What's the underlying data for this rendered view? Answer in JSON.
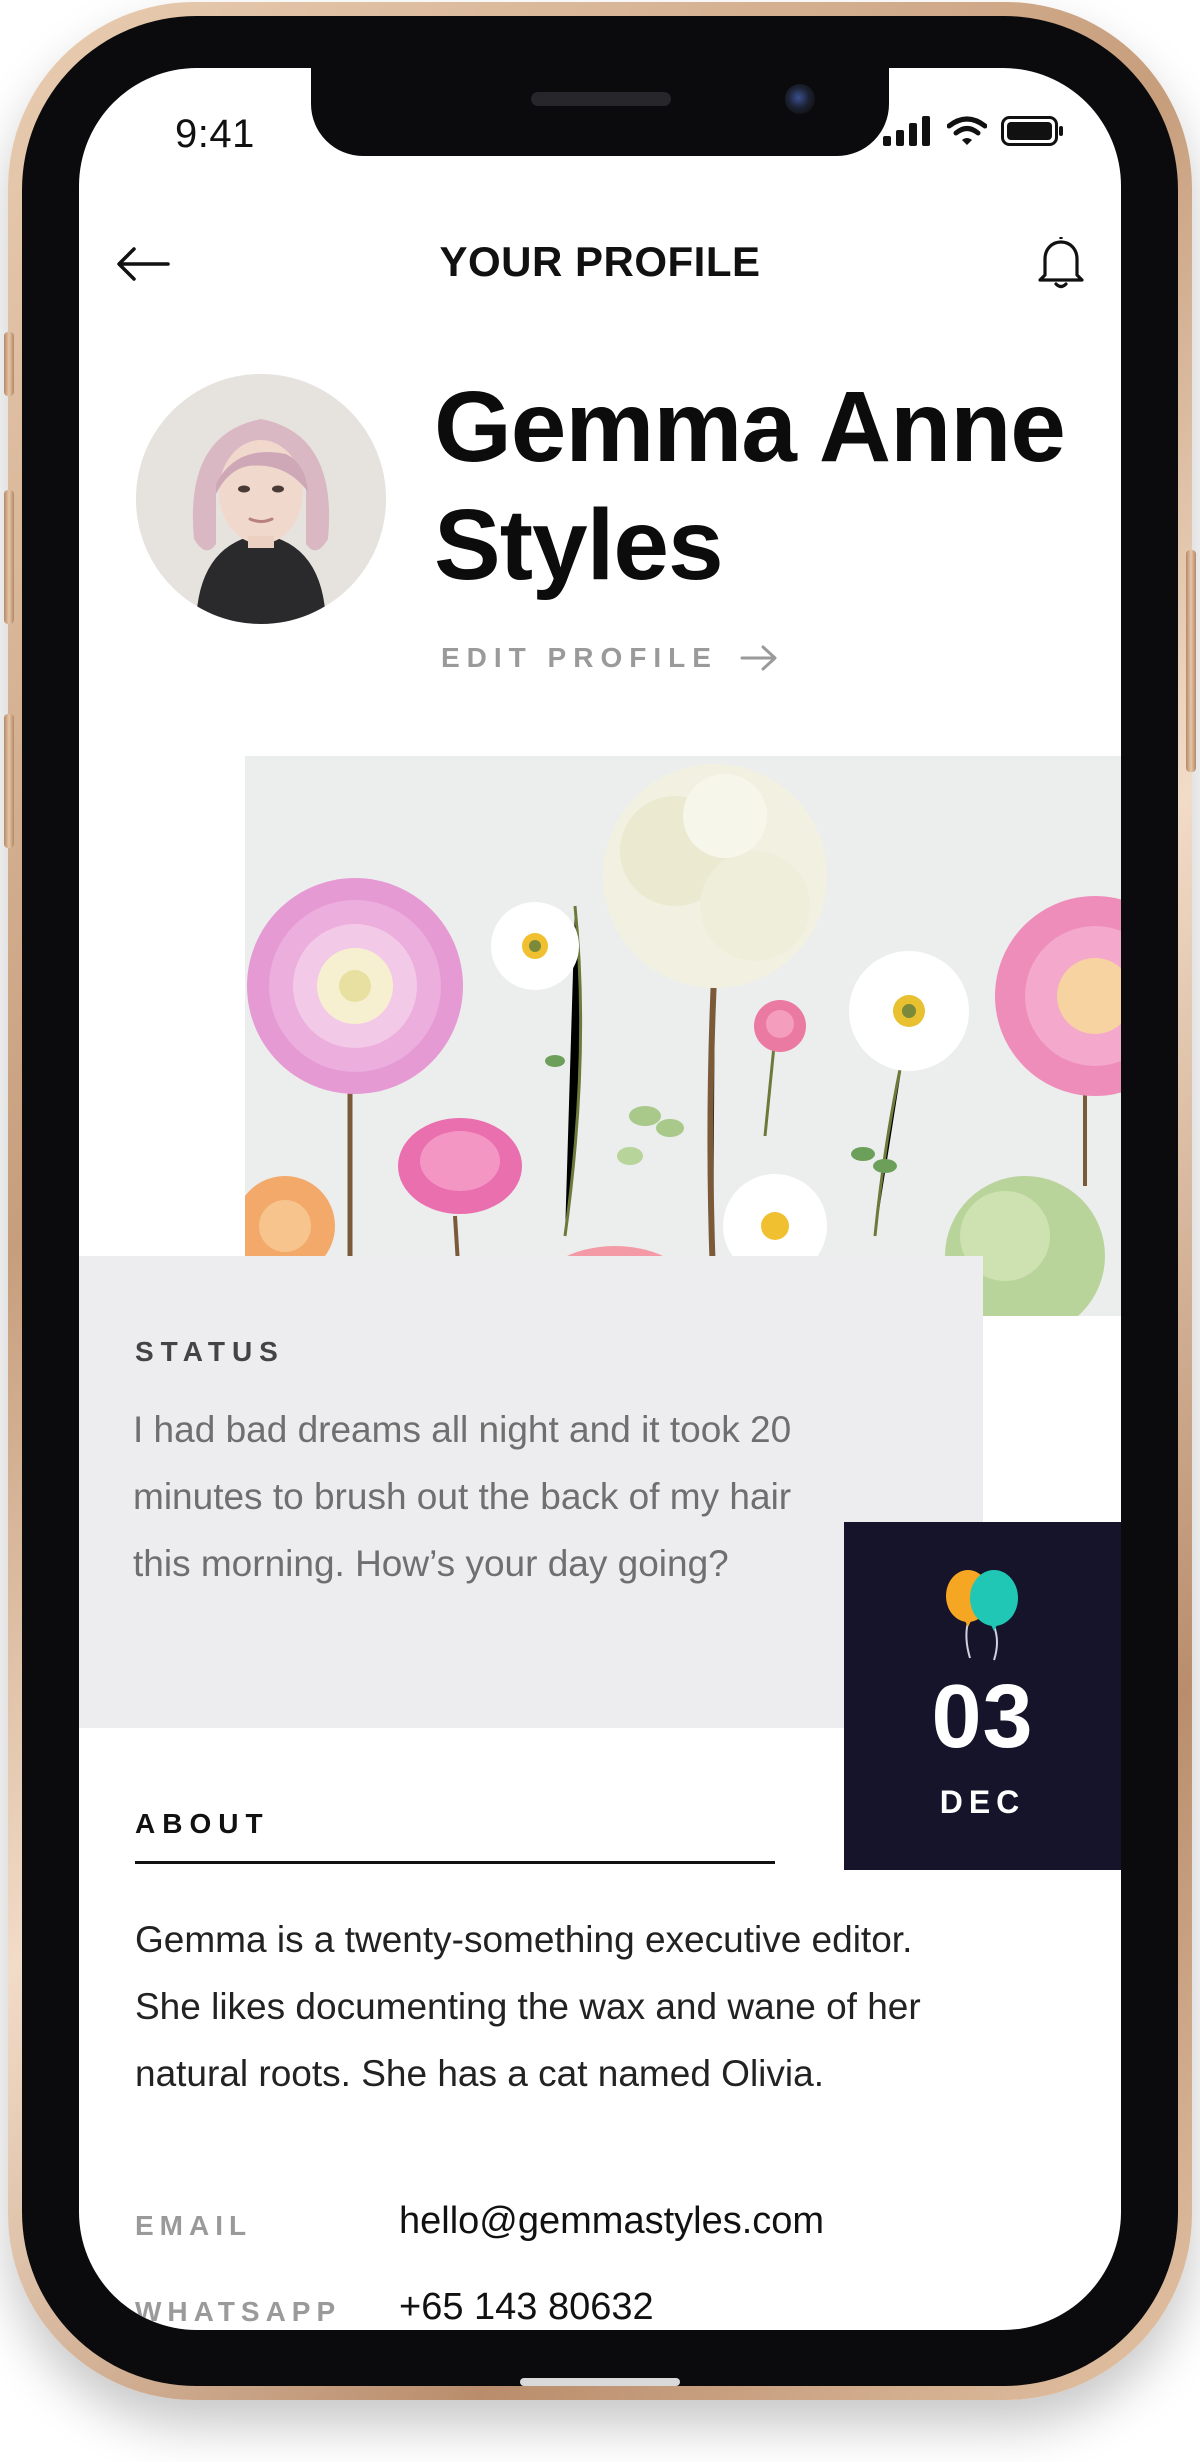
{
  "status_bar": {
    "time": "9:41"
  },
  "header": {
    "title": "YOUR PROFILE",
    "back_icon": "arrow-left-icon",
    "notification_icon": "bell-icon"
  },
  "profile": {
    "name": "Gemma Anne Styles",
    "edit_label": "EDIT PROFILE",
    "edit_icon": "arrow-right-icon"
  },
  "status": {
    "label": "STATUS",
    "text": "I had bad dreams all night and it took 20 minutes to brush out the back of my hair this morning. How’s your day going?"
  },
  "birthday": {
    "icon": "balloons-icon",
    "day": "03",
    "month": "DEC"
  },
  "about": {
    "label": "ABOUT",
    "text": "Gemma is a twenty-something executive editor. She likes documenting the wax and wane of her natural roots. She has a cat named Olivia."
  },
  "contacts": [
    {
      "label": "EMAIL",
      "value": "hello@gemmastyles.com"
    },
    {
      "label": "WHATSAPP",
      "value": "+65 143 80632"
    }
  ],
  "colors": {
    "accent_dark": "#15142b",
    "status_background": "#ededef",
    "muted_text": "#9a9a9a",
    "phone_gold": "#c79e7c"
  }
}
